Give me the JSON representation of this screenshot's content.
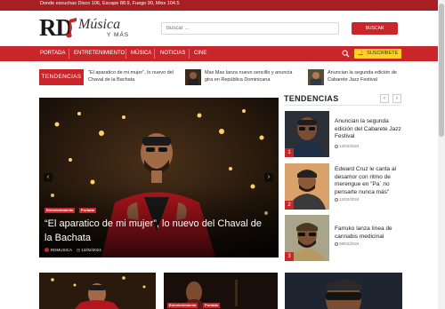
{
  "topbar": {
    "stations": "Donde escuchas Disco 106, Escape 88.9, Fuego 90, Mixx 104.5"
  },
  "logo": {
    "rd": "RD",
    "musica": "Música",
    "ymas": "Y MÁS"
  },
  "search": {
    "placeholder": "Buscar ...",
    "button": "BUSCAR"
  },
  "nav": {
    "items": [
      "PORTADA",
      "ENTRETENIMIENTO",
      "MÚSICA",
      "NOTICIAS",
      "CINE"
    ],
    "subscribe": "SUSCRÍBETE",
    "search_icon": "search-icon",
    "bell_icon": "bell-icon"
  },
  "ticker": {
    "label": "TENDENCIAS",
    "items": [
      {
        "title": "\"El aparatico de mi mujer\", lo nuevo del Chaval de la Bachata"
      },
      {
        "title": "Max Max lanza nuevo sencillo y anuncia gira en República Dominicana"
      },
      {
        "title": "Anuncian la segunda edición de Cabarete Jazz Festival"
      }
    ]
  },
  "hero": {
    "categories": [
      "Entretenimiento",
      "Portada"
    ],
    "title": "“El aparatico de mi mujer”, lo nuevo del Chaval de la Bachata",
    "author": "RDMUSICA",
    "date": "12/02/2024",
    "prev": "‹",
    "next": "›"
  },
  "sidebar": {
    "heading": "TENDENCIAS",
    "prev": "‹",
    "next": "›",
    "items": [
      {
        "num": "1",
        "title": "Anuncian la segunda edición del Cabarete Jazz Festival",
        "date": "12/02/2024"
      },
      {
        "num": "2",
        "title": "Edward Cruz le canta al desamor con ritmo de merengue en \"Pa´ no pensarte nunca más\"",
        "date": "12/02/2024"
      },
      {
        "num": "3",
        "title": "Farruko lanza línea de cannabis medicinal",
        "date": "08/02/2024"
      }
    ]
  },
  "bottom": {
    "categories": [
      "Entretenimiento",
      "Portada"
    ]
  },
  "colors": {
    "brand_red": "#c8262a",
    "dark_red": "#a71f23",
    "subscribe_yellow": "#ffd21f"
  }
}
